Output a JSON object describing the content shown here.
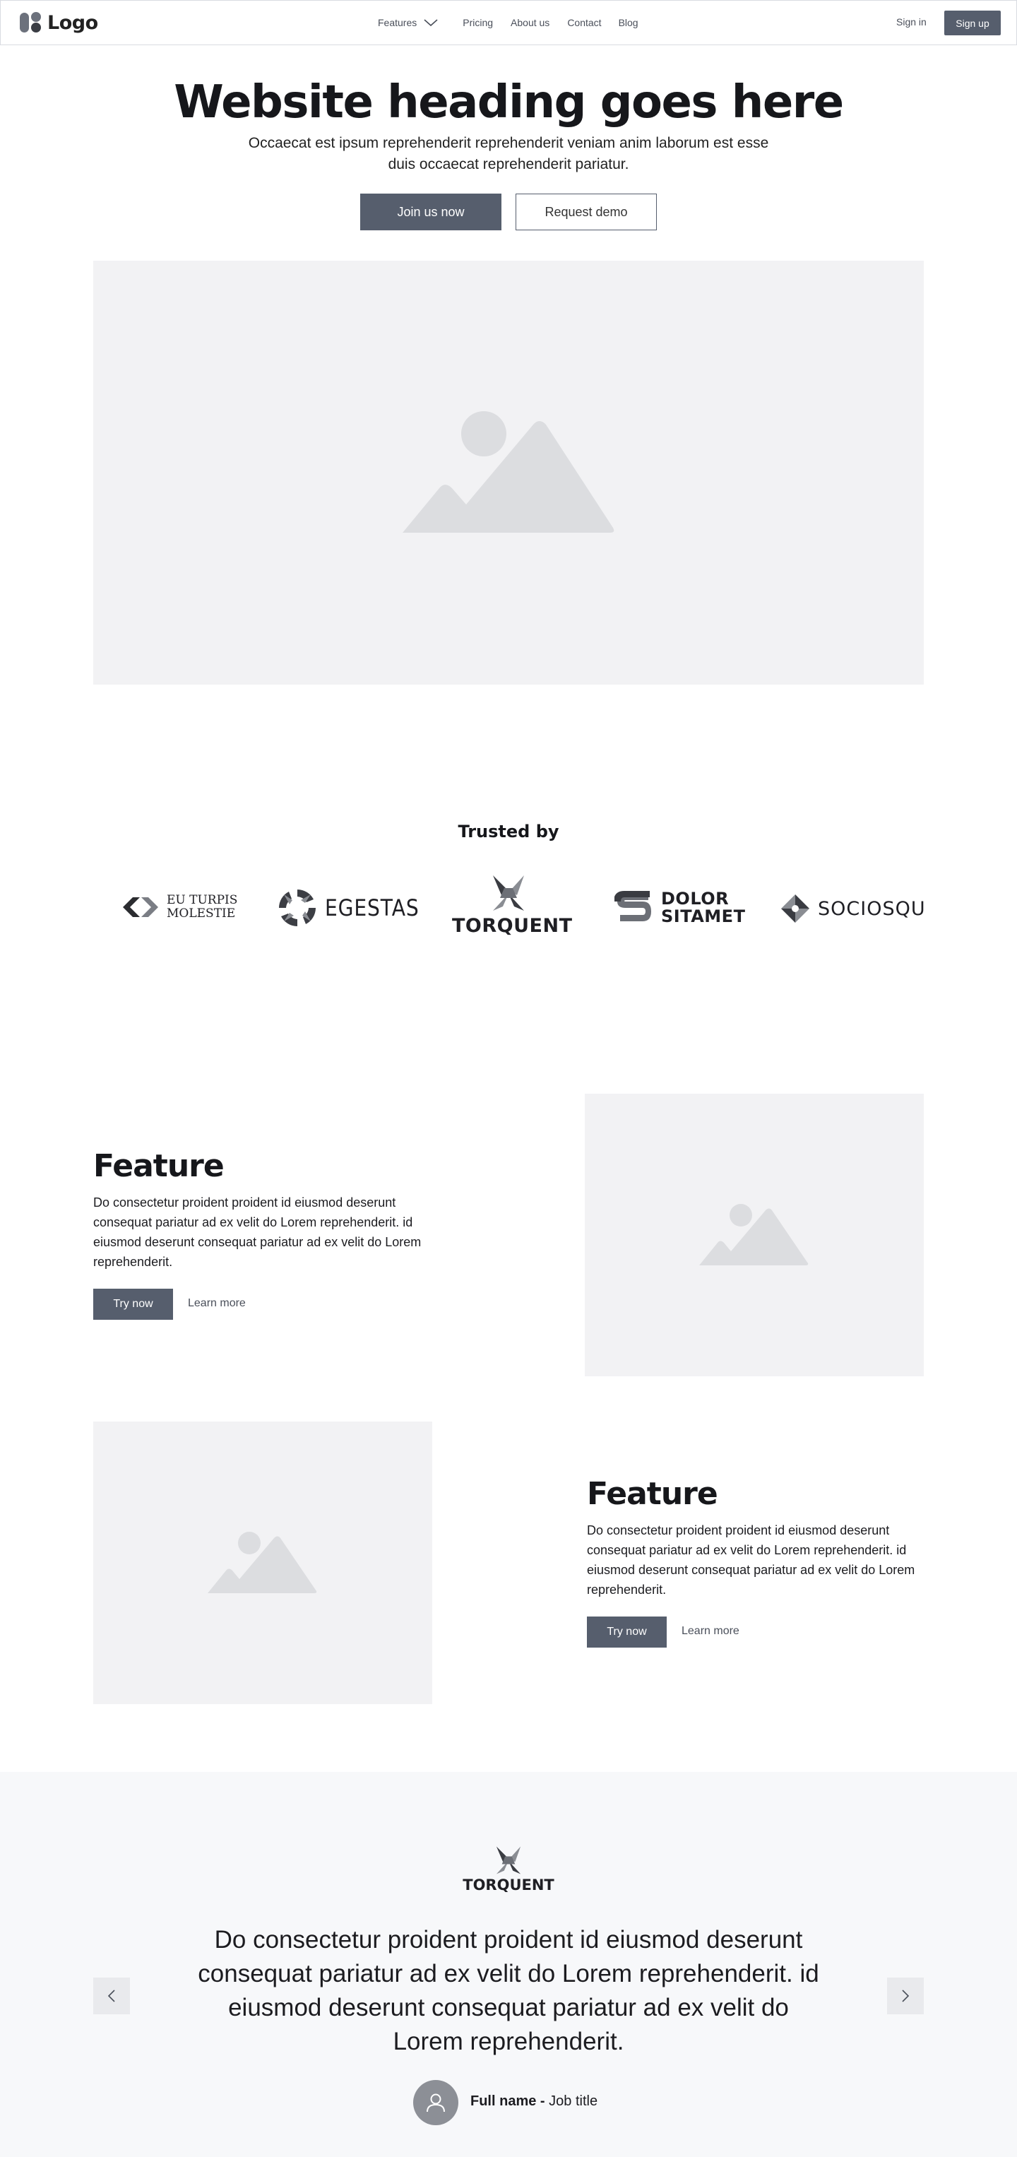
{
  "nav": {
    "logo_text": "Logo",
    "links": [
      "Features",
      "Pricing",
      "About us",
      "Contact",
      "Blog"
    ],
    "sign_in": "Sign in",
    "sign_up": "Sign up"
  },
  "hero": {
    "title": "Website heading goes here",
    "subtitle": "Occaecat est ipsum reprehenderit reprehenderit veniam anim laborum est esse duis occaecat reprehenderit pariatur.",
    "primary_cta": "Join us now",
    "secondary_cta": "Request demo"
  },
  "trusted": {
    "title": "Trusted by",
    "brands": [
      {
        "line1": "EU TURPIS",
        "line2": "MOLESTIE"
      },
      {
        "line1": "EGESTAS"
      },
      {
        "line1": "TORQUENT"
      },
      {
        "line1": "DOLOR",
        "line2": "SITAMET"
      },
      {
        "line1": "SOCIOSQU"
      }
    ]
  },
  "features": [
    {
      "title": "Feature",
      "body": "Do consectetur proident proident id eiusmod deserunt consequat pariatur ad ex velit do Lorem reprehenderit. id eiusmod deserunt consequat pariatur ad ex velit do Lorem reprehenderit.",
      "cta": "Try now",
      "link": "Learn more"
    },
    {
      "title": "Feature",
      "body": "Do consectetur proident proident id eiusmod deserunt consequat pariatur ad ex velit do Lorem reprehenderit. id eiusmod deserunt consequat pariatur ad ex velit do Lorem reprehenderit.",
      "cta": "Try now",
      "link": "Learn more"
    }
  ],
  "testimonial": {
    "brand": "TORQUENT",
    "quote": "Do consectetur proident proident id eiusmod deserunt consequat pariatur ad ex velit do Lorem reprehenderit. id eiusmod deserunt consequat pariatur ad ex velit do Lorem reprehenderit.",
    "name": "Full name -",
    "job": "Job title"
  },
  "colors": {
    "button": "#565e6d",
    "placeholder_bg": "#f2f2f4",
    "placeholder_icon": "#dcdde0",
    "testimonial_bg": "#f7f8fa"
  },
  "icons": [
    "logo-mark-icon",
    "chevron-down-icon",
    "image-placeholder-icon",
    "chevron-left-icon",
    "chevron-right-icon",
    "user-icon"
  ]
}
